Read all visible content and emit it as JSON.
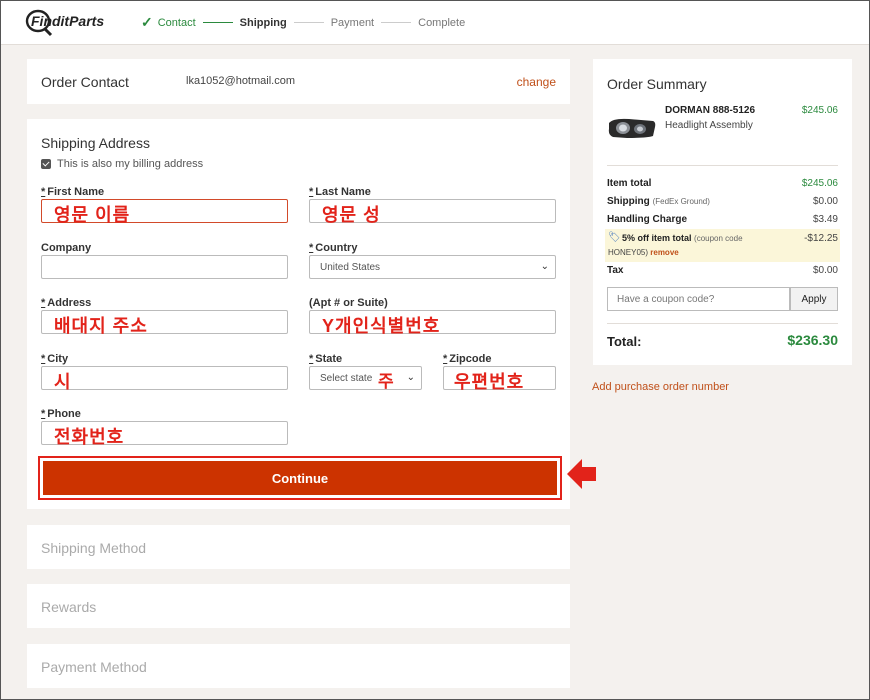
{
  "header": {
    "logo_text": "FinditParts",
    "steps": [
      {
        "label": "Contact",
        "state": "done"
      },
      {
        "label": "Shipping",
        "state": "current"
      },
      {
        "label": "Payment",
        "state": "todo"
      },
      {
        "label": "Complete",
        "state": "todo"
      }
    ]
  },
  "contact": {
    "title": "Order Contact",
    "email": "lka1052@hotmail.com",
    "change_label": "change"
  },
  "shipping": {
    "title": "Shipping Address",
    "billing_label": "This is also my billing address",
    "fields": {
      "first_name": {
        "label": "First Name",
        "required": "*",
        "overlay": "영문 이름"
      },
      "last_name": {
        "label": "Last Name",
        "required": "*",
        "overlay": "영문 성"
      },
      "company": {
        "label": "Company"
      },
      "country": {
        "label": "Country",
        "required": "*",
        "value": "United States"
      },
      "address": {
        "label": "Address",
        "required": "*",
        "overlay": "배대지 주소"
      },
      "apt": {
        "label": "(Apt # or Suite)",
        "overlay": "Y개인식별번호"
      },
      "city": {
        "label": "City",
        "required": "*",
        "overlay": "시"
      },
      "state": {
        "label": "State",
        "required": "*",
        "value": "Select state",
        "overlay": "주"
      },
      "zipcode": {
        "label": "Zipcode",
        "required": "*",
        "overlay": "우편번호"
      },
      "phone": {
        "label": "Phone",
        "required": "*",
        "overlay": "전화번호"
      }
    },
    "continue_label": "Continue"
  },
  "sections": {
    "shipping_method": "Shipping Method",
    "rewards": "Rewards",
    "payment_method": "Payment Method"
  },
  "summary": {
    "title": "Order Summary",
    "product": {
      "name": "DORMAN 888-5126",
      "desc": "Headlight Assembly",
      "price": "$245.06"
    },
    "item_total": {
      "label": "Item total",
      "value": "$245.06"
    },
    "shipping": {
      "label": "Shipping",
      "note": "(FedEx Ground)",
      "value": "$0.00"
    },
    "handling": {
      "label": "Handling Charge",
      "value": "$3.49"
    },
    "discount": {
      "label": "5% off item total",
      "note": "(coupon code",
      "code": "HONEY05)",
      "remove": "remove",
      "value": "-$12.25"
    },
    "tax": {
      "label": "Tax",
      "value": "$0.00"
    },
    "coupon_placeholder": "Have a coupon code?",
    "apply_label": "Apply",
    "total": {
      "label": "Total:",
      "value": "$236.30"
    },
    "po_link": "Add purchase order number"
  },
  "colors": {
    "accent": "#cc3300",
    "green": "#2b8a3e",
    "annotation": "#e2231a"
  }
}
